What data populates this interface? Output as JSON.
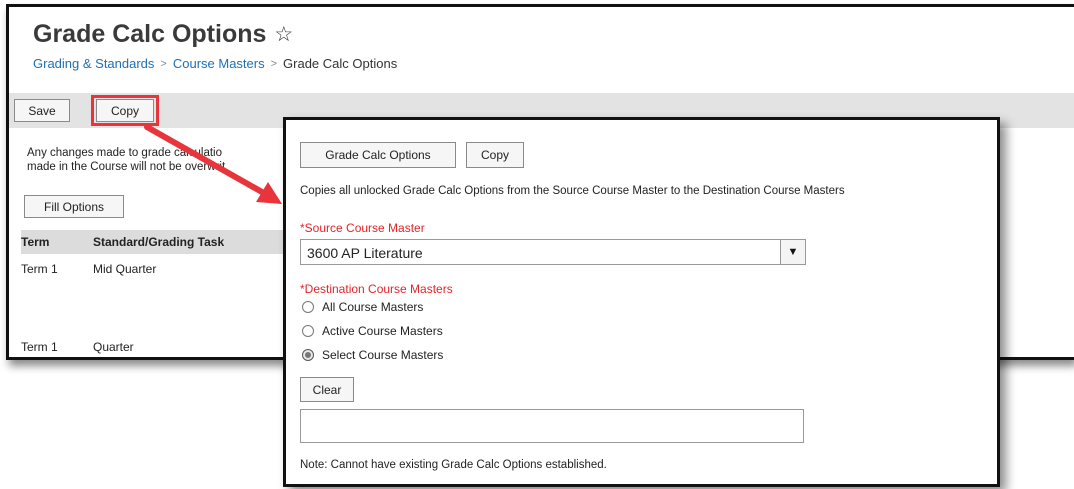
{
  "page": {
    "title": "Grade Calc Options",
    "breadcrumb": [
      "Grading & Standards",
      "Course Masters",
      "Grade Calc Options"
    ]
  },
  "toolbar": {
    "save_label": "Save",
    "copy_label": "Copy"
  },
  "main": {
    "message_line1": "Any changes made to grade calculatio",
    "message_line2": "made in the Course will not be overwrit",
    "fill_options_label": "Fill Options",
    "table": {
      "headers": [
        "Term",
        "Standard/Grading Task"
      ],
      "rows": [
        {
          "term": "Term 1",
          "task": "Mid Quarter"
        },
        {
          "term": "Term 1",
          "task": "Quarter"
        }
      ]
    }
  },
  "dialog": {
    "tabs": {
      "grade_calc_label": "Grade Calc Options",
      "copy_label": "Copy"
    },
    "description": "Copies all unlocked Grade Calc Options from the Source Course Master to the Destination Course Masters",
    "source_label": "*Source Course Master",
    "source_value": "3600 AP Literature",
    "destination_label": "*Destination Course Masters",
    "radios": [
      {
        "label": "All Course Masters",
        "selected": false
      },
      {
        "label": "Active Course Masters",
        "selected": false
      },
      {
        "label": "Select Course Masters",
        "selected": true
      }
    ],
    "clear_label": "Clear",
    "note": "Note: Cannot have existing Grade Calc Options established."
  },
  "icons": {
    "favorite": "star-outline-icon",
    "breadcrumb_separator": "chevron-right-icon",
    "dropdown": "caret-down-icon"
  },
  "colors": {
    "accent_link": "#1f6fb4",
    "highlight": "#e8343b",
    "required": "#e5242a"
  }
}
